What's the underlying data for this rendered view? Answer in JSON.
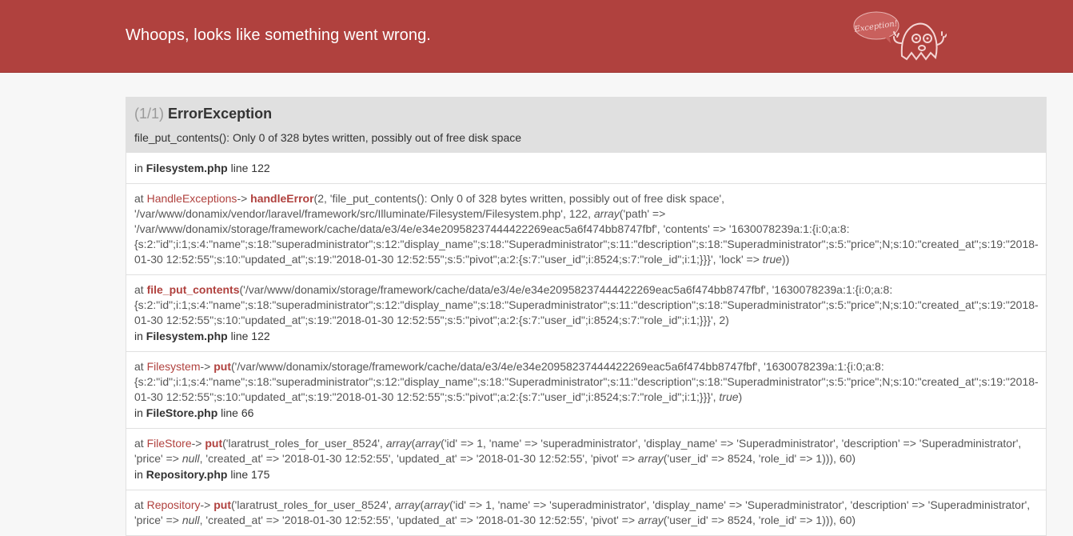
{
  "header": {
    "title": "Whoops, looks like something went wrong.",
    "mascot_label": "Exception!"
  },
  "exception": {
    "count": "(1/1)",
    "class": "ErrorException",
    "message": "file_put_contents(): Only 0 of 328 bytes written, possibly out of free disk space"
  },
  "trace": [
    {
      "type": "location",
      "in": "in",
      "file": "Filesystem.php",
      "line_word": "line",
      "line": "122"
    },
    {
      "type": "call",
      "at": "at",
      "class": "HandleExceptions",
      "arrow": "->",
      "function": "handleError",
      "args_html": "2, 'file_put_contents(): Only 0 of 328 bytes written, possibly out of free disk space', '/var/www/donamix/vendor/laravel/framework/src/Illuminate/Filesystem/Filesystem.php', 122, <span class=\"arr\">array</span>('path' => '/var/www/donamix/storage/framework/cache/data/e3/4e/e34e20958237444422269eac5a6f474bb8747fbf', 'contents' => '1630078239a:1:{i:0;a:8:{s:2:\"id\";i:1;s:4:\"name\";s:18:\"superadministrator\";s:12:\"display_name\";s:18:\"Superadministrator\";s:11:\"description\";s:18:\"Superadministrator\";s:5:\"price\";N;s:10:\"created_at\";s:19:\"2018-01-30 12:52:55\";s:10:\"updated_at\";s:19:\"2018-01-30 12:52:55\";s:5:\"pivot\";a:2:{s:7:\"user_id\";i:8524;s:7:\"role_id\";i:1;}}}', 'lock' => <span class=\"arr\">true</span>))",
      "file": "",
      "line": ""
    },
    {
      "type": "call",
      "at": "at",
      "class": "",
      "arrow": "",
      "function": "file_put_contents",
      "args_html": "'/var/www/donamix/storage/framework/cache/data/e3/4e/e34e20958237444422269eac5a6f474bb8747fbf', '1630078239a:1:{i:0;a:8:{s:2:\"id\";i:1;s:4:\"name\";s:18:\"superadministrator\";s:12:\"display_name\";s:18:\"Superadministrator\";s:11:\"description\";s:18:\"Superadministrator\";s:5:\"price\";N;s:10:\"created_at\";s:19:\"2018-01-30 12:52:55\";s:10:\"updated_at\";s:19:\"2018-01-30 12:52:55\";s:5:\"pivot\";a:2:{s:7:\"user_id\";i:8524;s:7:\"role_id\";i:1;}}}', 2)",
      "in": "in",
      "file": "Filesystem.php",
      "line_word": "line",
      "line": "122"
    },
    {
      "type": "call",
      "at": "at",
      "class": "Filesystem",
      "arrow": "->",
      "function": "put",
      "args_html": "'/var/www/donamix/storage/framework/cache/data/e3/4e/e34e20958237444422269eac5a6f474bb8747fbf', '1630078239a:1:{i:0;a:8:{s:2:\"id\";i:1;s:4:\"name\";s:18:\"superadministrator\";s:12:\"display_name\";s:18:\"Superadministrator\";s:11:\"description\";s:18:\"Superadministrator\";s:5:\"price\";N;s:10:\"created_at\";s:19:\"2018-01-30 12:52:55\";s:10:\"updated_at\";s:19:\"2018-01-30 12:52:55\";s:5:\"pivot\";a:2:{s:7:\"user_id\";i:8524;s:7:\"role_id\";i:1;}}}', <span class=\"arr\">true</span>)",
      "in": "in",
      "file": "FileStore.php",
      "line_word": "line",
      "line": "66"
    },
    {
      "type": "call",
      "at": "at",
      "class": "FileStore",
      "arrow": "->",
      "function": "put",
      "args_html": "'laratrust_roles_for_user_8524', <span class=\"arr\">array</span>(<span class=\"arr\">array</span>('id' => 1, 'name' => 'superadministrator', 'display_name' => 'Superadministrator', 'description' => 'Superadministrator', 'price' => <span class=\"arr\">null</span>, 'created_at' => '2018-01-30 12:52:55', 'updated_at' => '2018-01-30 12:52:55', 'pivot' => <span class=\"arr\">array</span>('user_id' => 8524, 'role_id' => 1))), 60)",
      "in": "in",
      "file": "Repository.php",
      "line_word": "line",
      "line": "175"
    },
    {
      "type": "call",
      "at": "at",
      "class": "Repository",
      "arrow": "->",
      "function": "put",
      "args_html": "'laratrust_roles_for_user_8524', <span class=\"arr\">array</span>(<span class=\"arr\">array</span>('id' => 1, 'name' => 'superadministrator', 'display_name' => 'Superadministrator', 'description' => 'Superadministrator', 'price' => <span class=\"arr\">null</span>, 'created_at' => '2018-01-30 12:52:55', 'updated_at' => '2018-01-30 12:52:55', 'pivot' => <span class=\"arr\">array</span>('user_id' => 8524, 'role_id' => 1))), 60)",
      "file": "",
      "line": ""
    }
  ],
  "colors": {
    "header_bg": "#b0413e",
    "page_bg": "#f7f7f7",
    "panel_head_bg": "#e0e0e0",
    "accent": "#b0413e"
  }
}
